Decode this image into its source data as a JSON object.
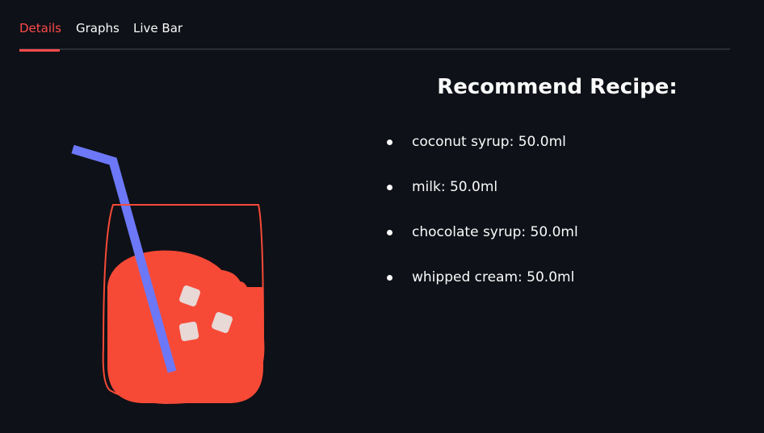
{
  "tabs": [
    {
      "label": "Details",
      "active": true
    },
    {
      "label": "Graphs",
      "active": false
    },
    {
      "label": "Live Bar",
      "active": false
    }
  ],
  "colors": {
    "background": "#0e1117",
    "accent": "#ff4b4b",
    "drink": "#f64a37",
    "straw": "#6c78f7",
    "ice": "#e8d8d6"
  },
  "illustration": {
    "icon": "drink-glass-with-straw-icon"
  },
  "recipe": {
    "title": "Recommend Recipe:",
    "ingredients": [
      "coconut syrup: 50.0ml",
      "milk: 50.0ml",
      "chocolate syrup: 50.0ml",
      "whipped cream: 50.0ml"
    ]
  }
}
